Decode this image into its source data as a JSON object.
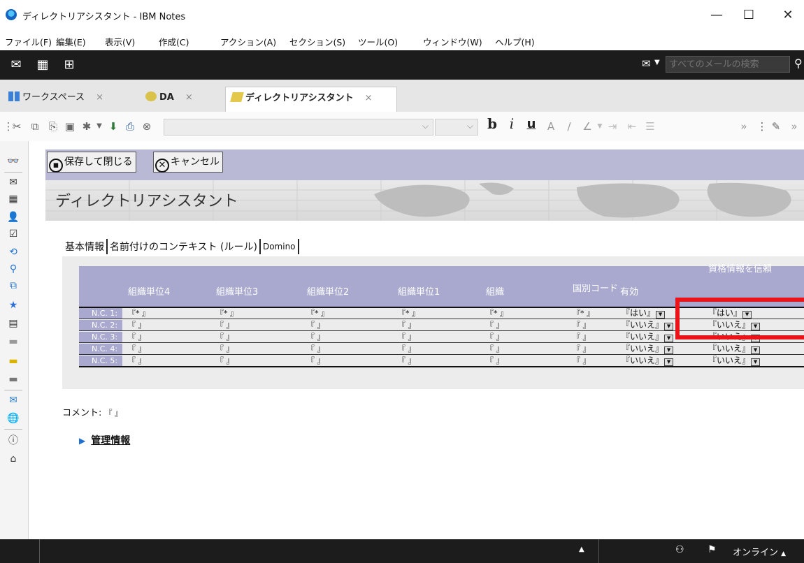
{
  "window": {
    "title": "ディレクトリアシスタント - IBM Notes",
    "minimize": "—",
    "maximize": "☐",
    "close": "✕"
  },
  "menu": [
    "ファイル(F)",
    "編集(E)",
    "表示(V)",
    "作成(C)",
    "アクション(A)",
    "セクション(S)",
    "ツール(O)",
    "ウィンドウ(W)",
    "ヘルプ(H)"
  ],
  "search": {
    "placeholder": "すべてのメールの検索"
  },
  "tabs": [
    {
      "label": "ワークスペース",
      "close": "×"
    },
    {
      "label": "DA",
      "close": "×"
    },
    {
      "label": "ディレクトリアシスタント",
      "close": "×"
    }
  ],
  "format": {
    "bold": "b",
    "italic": "i",
    "underline": "u"
  },
  "actions": {
    "save_close": "保存して閉じる",
    "cancel": "キャンセル"
  },
  "banner": {
    "title": "ディレクトリアシスタント"
  },
  "subtabs": [
    "基本情報",
    "名前付けのコンテキスト (ルール)",
    "Domino"
  ],
  "table": {
    "headers": [
      "組織単位4",
      "組織単位3",
      "組織単位2",
      "組織単位1",
      "組織",
      "国別コード",
      "有効",
      "資格情報を信頼"
    ],
    "rows": [
      {
        "nc": "N.C. 1:",
        "cells": [
          "『* 』",
          "『* 』",
          "『* 』",
          "『* 』",
          "『* 』",
          "『* 』"
        ],
        "enabled": "『はい』",
        "trust": "『はい』"
      },
      {
        "nc": "N.C. 2:",
        "cells": [
          "『 』",
          "『 』",
          "『 』",
          "『 』",
          "『 』",
          "『 』"
        ],
        "enabled": "『いいえ』",
        "trust": "『いいえ』"
      },
      {
        "nc": "N.C. 3:",
        "cells": [
          "『 』",
          "『 』",
          "『 』",
          "『 』",
          "『 』",
          "『 』"
        ],
        "enabled": "『いいえ』",
        "trust": "『いいえ』"
      },
      {
        "nc": "N.C. 4:",
        "cells": [
          "『 』",
          "『 』",
          "『 』",
          "『 』",
          "『 』",
          "『 』"
        ],
        "enabled": "『いいえ』",
        "trust": "『いいえ』"
      },
      {
        "nc": "N.C. 5:",
        "cells": [
          "『 』",
          "『 』",
          "『 』",
          "『 』",
          "『 』",
          "『 』"
        ],
        "enabled": "『いいえ』",
        "trust": "『いいえ』"
      }
    ]
  },
  "comment": {
    "label": "コメント:",
    "value": "『 』"
  },
  "admin_section": {
    "label": "管理情報"
  },
  "status": {
    "online": "オンライン"
  },
  "colors": {
    "accent": "#a9a9cf",
    "highlight": "#e8141a",
    "black_bar": "#1c1c1c"
  }
}
